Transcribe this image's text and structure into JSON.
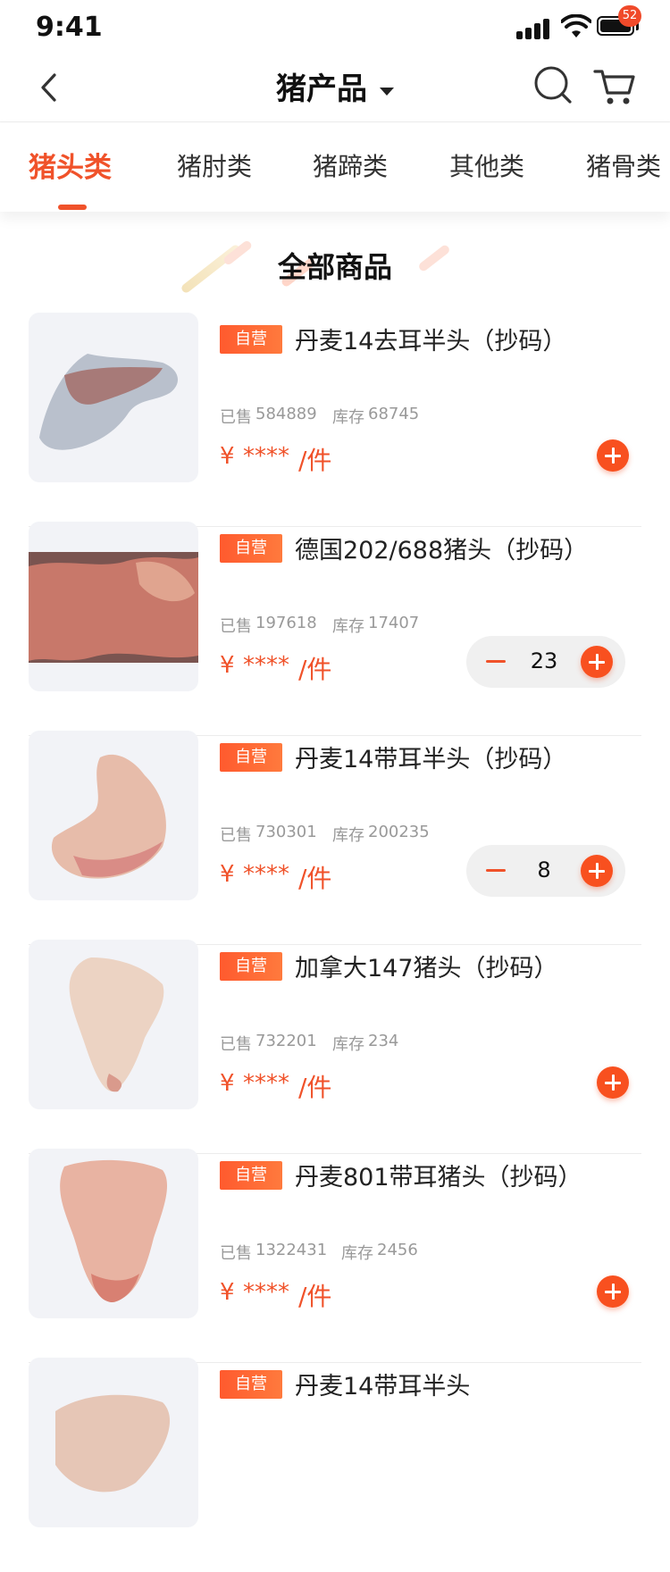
{
  "status_bar": {
    "time": "9:41"
  },
  "nav": {
    "title": "猪产品",
    "cart_badge": "52"
  },
  "tabs": [
    {
      "label": "猪头类",
      "active": true
    },
    {
      "label": "猪肘类",
      "active": false
    },
    {
      "label": "猪蹄类",
      "active": false
    },
    {
      "label": "其他类",
      "active": false
    },
    {
      "label": "猪骨类",
      "active": false
    }
  ],
  "section": {
    "title": "全部商品"
  },
  "colors": {
    "accent": "#f0522a",
    "tag": "#ff5a2e",
    "thumb_bg": "#f2f3f7"
  },
  "labels": {
    "tag": "自营",
    "sold": "已售",
    "stock": "库存",
    "currency": "¥",
    "price_hidden": "****",
    "unit": "/件"
  },
  "products": [
    {
      "name": "丹麦14去耳半头（抄码）",
      "sold": "584889",
      "stock": "68745",
      "quantity": null
    },
    {
      "name": "德国202/688猪头（抄码）",
      "sold": "197618",
      "stock": "17407",
      "quantity": "23"
    },
    {
      "name": "丹麦14带耳半头（抄码）",
      "sold": "730301",
      "stock": "200235",
      "quantity": "8"
    },
    {
      "name": "加拿大147猪头（抄码）",
      "sold": "732201",
      "stock": "234",
      "quantity": null
    },
    {
      "name": "丹麦801带耳猪头（抄码）",
      "sold": "1322431",
      "stock": "2456",
      "quantity": null
    },
    {
      "name": "丹麦14带耳半头",
      "sold": "",
      "stock": "",
      "quantity": null
    }
  ]
}
